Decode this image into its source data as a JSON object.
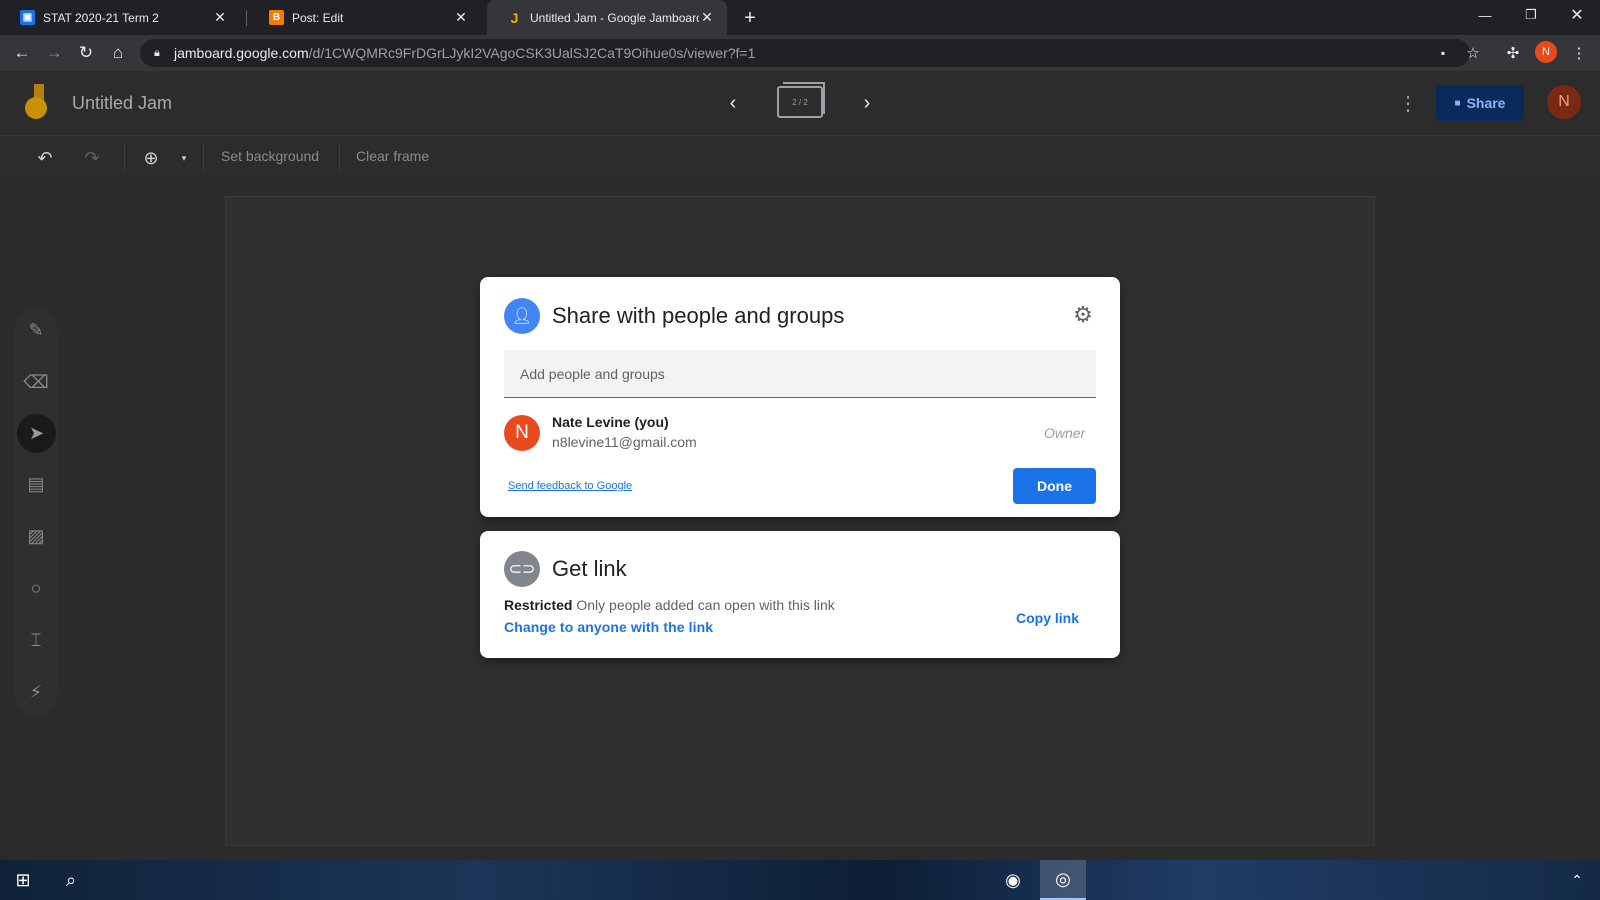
{
  "browser": {
    "tabs": [
      {
        "title": "STAT 2020-21 Term 2",
        "favicon": "classroom-icon",
        "color": "#1e8e3e"
      },
      {
        "title": "Post: Edit",
        "favicon": "blogger-icon",
        "color": "#f57c00"
      },
      {
        "title": "Untitled Jam - Google Jamboard",
        "favicon": "jamboard-icon",
        "color": "#f9ab00",
        "active": true
      }
    ],
    "url_host": "jamboard.google.com",
    "url_path": "/d/1CWQMRc9FrDGrLJykI2VAgoCSK3UalSJ2CaT9Oihue0s/viewer?f=1",
    "profile_initial": "N"
  },
  "app": {
    "title": "Untitled Jam",
    "frame_indicator": "2 / 2",
    "share_label": "Share",
    "user_initial": "N"
  },
  "toolbar": {
    "set_background": "Set background",
    "clear_frame": "Clear frame"
  },
  "share_dialog": {
    "title": "Share with people and groups",
    "input_placeholder": "Add people and groups",
    "person": {
      "initial": "N",
      "name": "Nate Levine (you)",
      "email": "n8levine11@gmail.com",
      "role": "Owner"
    },
    "feedback_link": "Send feedback to Google",
    "done_label": "Done"
  },
  "link_dialog": {
    "title": "Get link",
    "status": "Restricted",
    "description": "Only people added can open with this link",
    "change_link": "Change to anyone with the link",
    "copy_label": "Copy link"
  },
  "colors": {
    "accent": "#1a73e8",
    "avatar": "#e8491d"
  }
}
